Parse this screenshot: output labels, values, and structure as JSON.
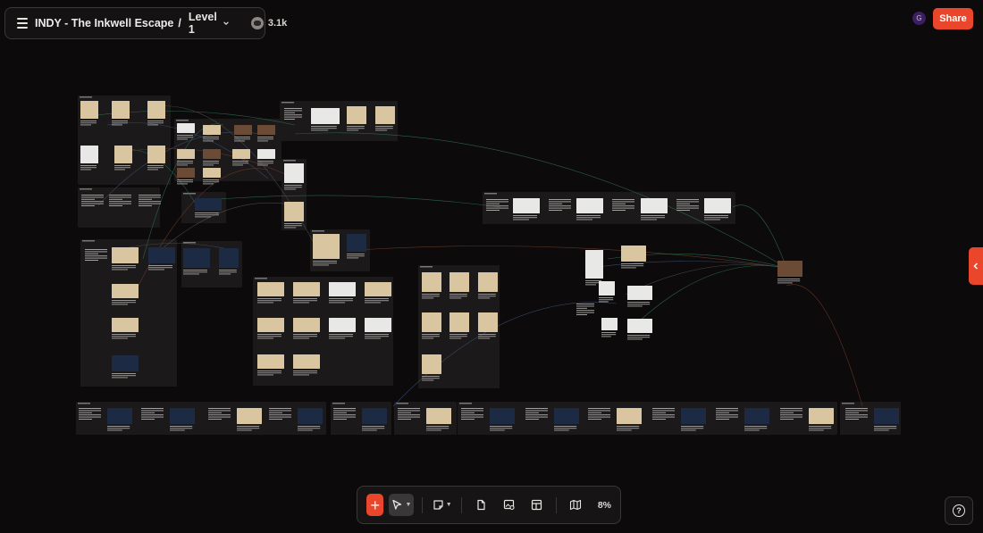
{
  "header": {
    "project_title": "INDY - The Inkwell Escape",
    "separator": "/",
    "level_label": "Level 1",
    "viewer_count": "3.1k"
  },
  "user": {
    "avatar_initial": "G"
  },
  "share": {
    "label": "Share"
  },
  "toolbar": {
    "add_label": "+",
    "zoom": "8%"
  },
  "help": {
    "label": "?"
  },
  "icons": {
    "menu": "hamburger-icon",
    "level_dropdown": "chevron-down-icon",
    "viewers": "viewers-avatar-icon",
    "side_panel": "chevron-left-icon",
    "cursor": "pointer-cursor-icon",
    "sticky": "sticky-note-icon",
    "page": "page-icon",
    "image": "image-search-icon",
    "layout": "layout-icon",
    "map": "map-icon",
    "help": "help-icon"
  },
  "colors": {
    "accent": "#e9462b",
    "background": "#0c0a0b",
    "panel": "#141213"
  }
}
